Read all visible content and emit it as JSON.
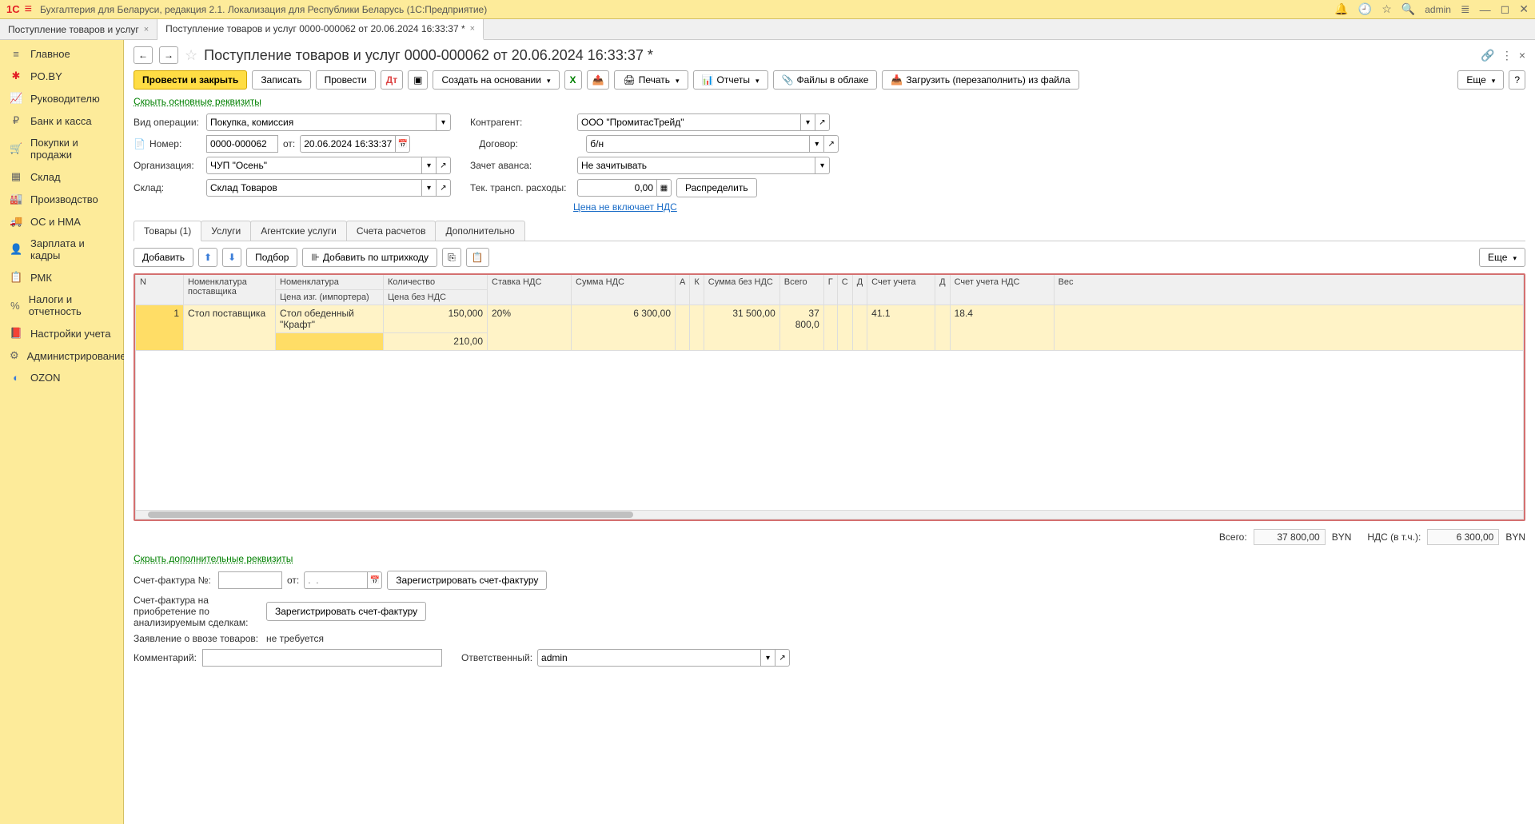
{
  "titleBar": {
    "appTitle": "Бухгалтерия для Беларуси, редакция 2.1. Локализация для Республики Беларусь  (1С:Предприятие)",
    "user": "admin"
  },
  "windowTabs": [
    {
      "label": "Поступление товаров и услуг",
      "active": false
    },
    {
      "label": "Поступление товаров и услуг 0000-000062 от 20.06.2024 16:33:37 *",
      "active": true
    }
  ],
  "nav": [
    {
      "label": "Главное",
      "icon": "≡"
    },
    {
      "label": "PO.BY",
      "icon": "✱",
      "cls": "red"
    },
    {
      "label": "Руководителю",
      "icon": "📈"
    },
    {
      "label": "Банк и касса",
      "icon": "₽"
    },
    {
      "label": "Покупки и продажи",
      "icon": "🛒"
    },
    {
      "label": "Склад",
      "icon": "▦"
    },
    {
      "label": "Производство",
      "icon": "🏭"
    },
    {
      "label": "ОС и НМА",
      "icon": "🚚"
    },
    {
      "label": "Зарплата и кадры",
      "icon": "👤"
    },
    {
      "label": "РМК",
      "icon": "📋"
    },
    {
      "label": "Налоги и отчетность",
      "icon": "%"
    },
    {
      "label": "Настройки учета",
      "icon": "📕"
    },
    {
      "label": "Администрирование",
      "icon": "⚙"
    },
    {
      "label": "OZON",
      "icon": "◐",
      "cls": "blue"
    }
  ],
  "docTitle": "Поступление товаров и услуг 0000-000062 от 20.06.2024 16:33:37 *",
  "toolbar": {
    "postClose": "Провести и закрыть",
    "save": "Записать",
    "post": "Провести",
    "createFrom": "Создать на основании",
    "print": "Печать",
    "reports": "Отчеты",
    "cloud": "Файлы в облаке",
    "loadFile": "Загрузить (перезаполнить) из файла",
    "more": "Еще"
  },
  "mainReqLink": "Скрыть основные реквизиты",
  "form": {
    "opTypeLabel": "Вид операции:",
    "opType": "Покупка, комиссия",
    "counterpartyLabel": "Контрагент:",
    "counterparty": "ООО \"ПромитасТрейд\"",
    "numberLabel": "Номер:",
    "number": "0000-000062",
    "fromLabel": "от:",
    "date": "20.06.2024 16:33:37",
    "contractLabel": "Договор:",
    "contract": "б/н",
    "orgLabel": "Организация:",
    "org": "ЧУП \"Осень\"",
    "advanceLabel": "Зачет аванса:",
    "advance": "Не зачитывать",
    "warehouseLabel": "Склад:",
    "warehouse": "Склад Товаров",
    "transpLabel": "Тек. трансп. расходы:",
    "transp": "0,00",
    "distribute": "Распределить",
    "vatLink": "Цена не включает НДС"
  },
  "innerTabs": [
    {
      "label": "Товары (1)",
      "active": true
    },
    {
      "label": "Услуги"
    },
    {
      "label": "Агентские услуги"
    },
    {
      "label": "Счета расчетов"
    },
    {
      "label": "Дополнительно"
    }
  ],
  "tblToolbar": {
    "add": "Добавить",
    "pick": "Подбор",
    "barcode": "Добавить по штрихкоду",
    "more": "Еще"
  },
  "gridHeaders": {
    "n": "N",
    "supplierNom": "Номенклатура поставщика",
    "nom": "Номенклатура",
    "mfrPrice": "Цена изг. (импортера)",
    "qty": "Количество",
    "priceNoVat": "Цена без НДС",
    "vatRate": "Ставка НДС",
    "vatSum": "Сумма НДС",
    "a": "А",
    "k": "К",
    "sumNoVat": "Сумма без НДС",
    "total": "Всего",
    "g": "Г",
    "c": "С",
    "d": "Д",
    "account": "Счет учета",
    "d2": "Д",
    "vatAccount": "Счет учета НДС",
    "weight": "Вес"
  },
  "gridRow": {
    "n": "1",
    "supplierNom": "Стол поставщика",
    "nom": "Стол обеденный \"Крафт\"",
    "qty": "150,000",
    "priceNoVat": "210,00",
    "vatRate": "20%",
    "vatSum": "6 300,00",
    "sumNoVat": "31 500,00",
    "total": "37 800,0",
    "account": "41.1",
    "vatAccount": "18.4"
  },
  "totals": {
    "totalLabel": "Всего:",
    "totalVal": "37 800,00",
    "cur": "BYN",
    "vatLabel": "НДС (в т.ч.):",
    "vatVal": "6 300,00"
  },
  "addlReqLink": "Скрыть дополнительные реквизиты",
  "bottom": {
    "invoiceNoLabel": "Счет-фактура №:",
    "fromLabel": "от:",
    "datePlaceholder": ".  .",
    "regInvoice": "Зарегистрировать счет-фактуру",
    "invoicePurchase": "Счет-фактура на приобретение по анализируемым сделкам:",
    "regInvoice2": "Зарегистрировать счет-фактуру",
    "importDecl": "Заявление о ввозе товаров:",
    "importDeclVal": "не требуется",
    "commentLabel": "Комментарий:",
    "responsibleLabel": "Ответственный:",
    "responsible": "admin"
  }
}
